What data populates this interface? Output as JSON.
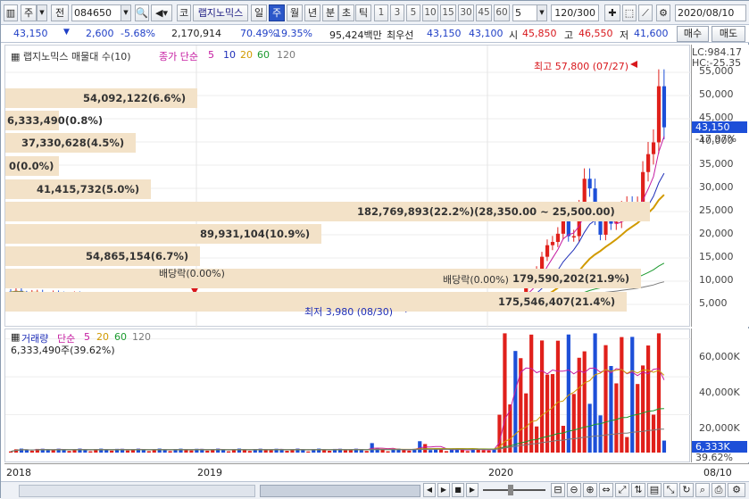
{
  "toolbar": {
    "mode1": "주",
    "mode2": "전",
    "code": "084650",
    "type_btn": "코",
    "name": "랩지노믹스",
    "periods": [
      "일",
      "주",
      "월",
      "년",
      "분",
      "초",
      "틱"
    ],
    "active_period": "주",
    "nums": [
      "1",
      "3",
      "5",
      "10",
      "15",
      "30",
      "45",
      "60"
    ],
    "count_sel": "5",
    "count": "120/300",
    "date": "2020/08/10"
  },
  "info": {
    "price": "43,150",
    "change": "2,600",
    "pct": "-5.68%",
    "volume": "2,170,914",
    "ratio": "70.49%",
    "turn": "19.35%",
    "amount": "95,424백만",
    "hoga_label": "최우선",
    "ask": "43,150",
    "bid": "43,100",
    "open_label": "시",
    "open": "45,850",
    "high_label": "고",
    "high": "46,550",
    "low_label": "저",
    "low": "41,600",
    "buy": "매수",
    "sell": "매도"
  },
  "legend": {
    "title": "랩지노믹스 매물대 수(10)",
    "ma_label": "종가 단순",
    "ma": [
      "5",
      "10",
      "20",
      "60",
      "120"
    ],
    "ma_colors": [
      "#c51ba0",
      "#1f2fb8",
      "#d19a00",
      "#1b9a2e",
      "#7a7a7a"
    ]
  },
  "bands": [
    {
      "text": "54,092,122(6.6%)",
      "frac": 0.066
    },
    {
      "text": "6,333,490(0.8%)",
      "frac": 0.008
    },
    {
      "text": "37,330,628(4.5%)",
      "frac": 0.045
    },
    {
      "text": "0(0.0%)",
      "frac": 0.0
    },
    {
      "text": "41,415,732(5.0%)",
      "frac": 0.05
    },
    {
      "text": "182,769,893(22.2%)(28,350.00 ~ 25,500.00)",
      "frac": 0.222
    },
    {
      "text": "89,931,104(10.9%)",
      "frac": 0.109
    },
    {
      "text": "54,865,154(6.7%)",
      "frac": 0.067
    },
    {
      "text": "179,590,202(21.9%)",
      "frac": 0.219
    },
    {
      "text": "175,546,407(21.4%)",
      "frac": 0.214
    }
  ],
  "annotations": {
    "high": "최고 57,800 (07/27)",
    "low": "최저 3,980 (08/30)",
    "div1": "배당락(0.00%)",
    "div2": "배당락(0.00%)"
  },
  "price_axis": {
    "ticks": [
      "55,000",
      "50,000",
      "45,000",
      "40,000",
      "35,000",
      "30,000",
      "25,000",
      "20,000",
      "15,000",
      "10,000",
      "5,000"
    ],
    "lc": "LC:984.17",
    "hc": "HC:-25.35",
    "current": "43,150",
    "current_pct": "-17.97%"
  },
  "volume": {
    "legend_title": "거래량",
    "ma_label": "단순",
    "ma": [
      "5",
      "20",
      "60",
      "120"
    ],
    "value_text": "6,333,490주(39.62%)",
    "ticks": [
      "60,000K",
      "40,000K",
      "20,000K"
    ],
    "current": "6,333K",
    "current_pct": "39.62%"
  },
  "dates": [
    "2018",
    "2019",
    "2020",
    "08/10"
  ],
  "chart_data": {
    "type": "candlestick",
    "title": "랩지노믹스",
    "period": "weekly",
    "ylim": [
      0,
      60000
    ],
    "high": {
      "value": 57800,
      "date": "07/27"
    },
    "low": {
      "value": 3980,
      "date": "08/30"
    },
    "last_close": 43150,
    "last_volume": 6333490
  },
  "colors": {
    "up": "#e0201b",
    "down": "#1d4fd8",
    "band": "#f3e2c8",
    "accent": "#2b57c9"
  }
}
